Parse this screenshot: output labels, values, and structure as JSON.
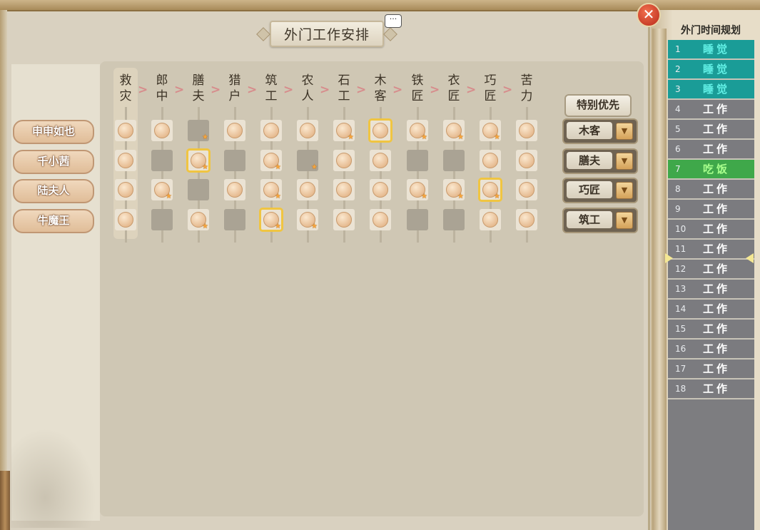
{
  "window": {
    "title": "外门工作安排",
    "close_label": "✕",
    "chat_label": "···"
  },
  "jobs": [
    "救灾",
    "郎中",
    "膳夫",
    "猎户",
    "筑工",
    "农人",
    "石工",
    "木客",
    "铁匠",
    "衣匠",
    "巧匠",
    "苦力"
  ],
  "arrow_glyph": ">",
  "workers": [
    {
      "name": "申申如也",
      "cells": [
        "c",
        "c",
        "es",
        "c",
        "c",
        "c",
        "cs",
        "cS",
        "cs",
        "cs",
        "cs",
        "c"
      ],
      "priority": "木客"
    },
    {
      "name": "千小茜",
      "cells": [
        "c",
        "e",
        "cSs",
        "e",
        "cs",
        "es",
        "c",
        "c",
        "e",
        "e",
        "c",
        "c"
      ],
      "priority": "膳夫"
    },
    {
      "name": "陆夫人",
      "cells": [
        "c",
        "cs",
        "e",
        "c",
        "cs",
        "c",
        "c",
        "c",
        "cs",
        "cs",
        "cSs",
        "c"
      ],
      "priority": "巧匠"
    },
    {
      "name": "牛魔王",
      "cells": [
        "c",
        "e",
        "cs",
        "e",
        "cSs",
        "cs",
        "c",
        "c",
        "e",
        "e",
        "c",
        "c"
      ],
      "priority": "筑工"
    }
  ],
  "priority_header": "特别优先",
  "schedule": {
    "title": "外门时间规划",
    "rows": [
      {
        "n": "1",
        "act": "睡觉",
        "type": "sleep"
      },
      {
        "n": "2",
        "act": "睡觉",
        "type": "sleep"
      },
      {
        "n": "3",
        "act": "睡觉",
        "type": "sleep"
      },
      {
        "n": "4",
        "act": "工作",
        "type": "work"
      },
      {
        "n": "5",
        "act": "工作",
        "type": "work"
      },
      {
        "n": "6",
        "act": "工作",
        "type": "work"
      },
      {
        "n": "7",
        "act": "吃饭",
        "type": "eat"
      },
      {
        "n": "8",
        "act": "工作",
        "type": "work"
      },
      {
        "n": "9",
        "act": "工作",
        "type": "work"
      },
      {
        "n": "10",
        "act": "工作",
        "type": "work"
      },
      {
        "n": "11",
        "act": "工作",
        "type": "work"
      },
      {
        "n": "12",
        "act": "工作",
        "type": "work"
      },
      {
        "n": "13",
        "act": "工作",
        "type": "work"
      },
      {
        "n": "14",
        "act": "工作",
        "type": "work"
      },
      {
        "n": "15",
        "act": "工作",
        "type": "work"
      },
      {
        "n": "16",
        "act": "工作",
        "type": "work"
      },
      {
        "n": "17",
        "act": "工作",
        "type": "work"
      },
      {
        "n": "18",
        "act": "工作",
        "type": "work"
      }
    ]
  },
  "colors": {
    "sleep": "#1a9c97",
    "work": "#7b7b7f",
    "eat": "#3fa84a",
    "selected": "#f0c541",
    "star": "#f7a43a"
  },
  "icons": {
    "close": "close-icon",
    "dropdown": "dropdown-arrow-icon",
    "job_coin": "job-coin-icon",
    "skill_star": "star-icon",
    "chat": "chat-bubble-icon"
  }
}
